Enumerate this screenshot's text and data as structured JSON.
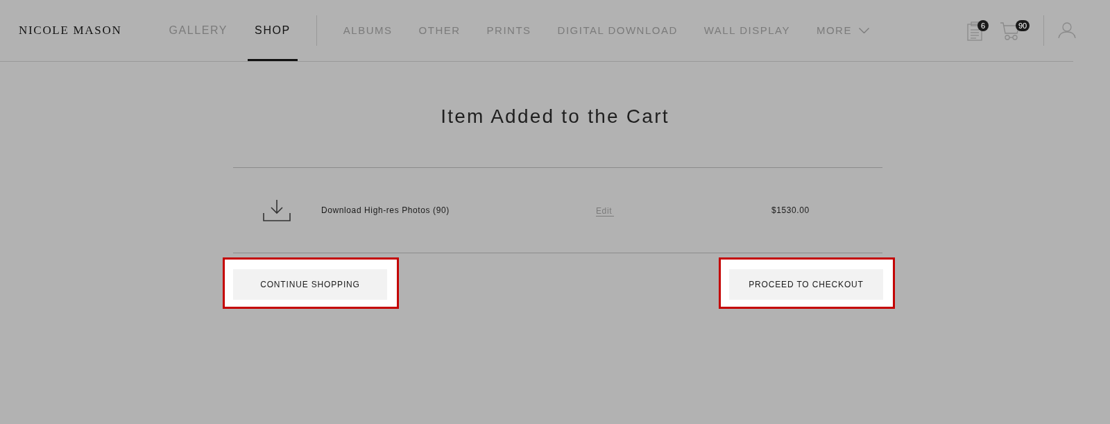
{
  "brand": {
    "name": "NICOLE MASON"
  },
  "nav": {
    "primary": [
      {
        "label": "GALLERY",
        "selected": false
      },
      {
        "label": "SHOP",
        "selected": true
      }
    ],
    "secondary": [
      {
        "label": "ALBUMS",
        "kind": "link"
      },
      {
        "label": "OTHER",
        "kind": "link"
      },
      {
        "label": "PRINTS",
        "kind": "link"
      },
      {
        "label": "DIGITAL DOWNLOAD",
        "kind": "link"
      },
      {
        "label": "WALL DISPLAY",
        "kind": "link"
      },
      {
        "label": "MORE",
        "kind": "dropdown"
      }
    ]
  },
  "header_icons": {
    "orders_badge": "6",
    "cart_badge": "90"
  },
  "page": {
    "title": "Item Added to the Cart"
  },
  "cart_items": [
    {
      "name": "Download High-res Photos (90)",
      "edit_link": "Edit",
      "price": "$1530.00"
    }
  ],
  "buttons": [
    {
      "label": "CONTINUE SHOPPING",
      "highlighted": true
    },
    {
      "label": "PROCEED TO CHECKOUT",
      "highlighted": true
    }
  ]
}
